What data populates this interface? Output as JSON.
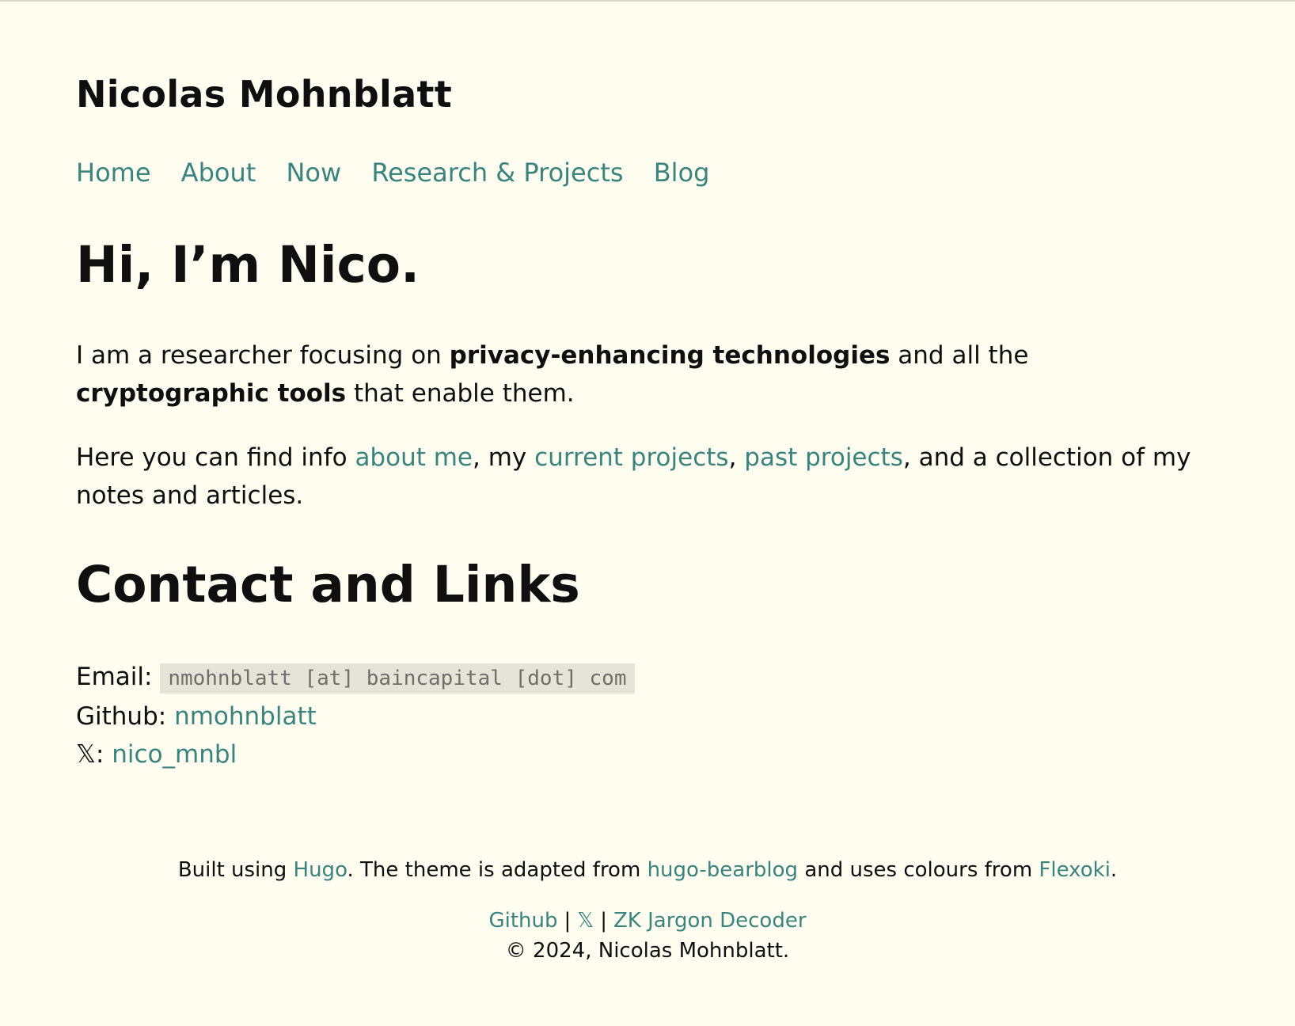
{
  "header": {
    "title": "Nicolas Mohnblatt"
  },
  "nav": {
    "items": [
      "Home",
      "About",
      "Now",
      "Research & Projects",
      "Blog"
    ]
  },
  "main": {
    "heading": "Hi, I’m Nico.",
    "intro": {
      "t1": "I am a researcher focusing on ",
      "b1": "privacy-enhancing technologies",
      "t2": " and all the ",
      "b2": "cryptographic tools",
      "t3": " that enable them."
    },
    "info": {
      "t1": "Here you can find info ",
      "link1": "about me",
      "t2": ", my ",
      "link2": "current projects",
      "t3": ", ",
      "link3": "past projects",
      "t4": ", and a collection of my notes and articles."
    },
    "contact_heading": "Contact and Links",
    "contact": {
      "email_label": "Email: ",
      "email_value": "nmohnblatt [at] baincapital [dot] com",
      "github_label": "Github: ",
      "github_value": "nmohnblatt",
      "x_label": "𝕏: ",
      "x_value": "nico_mnbl"
    }
  },
  "footer": {
    "line1": {
      "t1": "Built using ",
      "link1": "Hugo",
      "t2": ". The theme is adapted from ",
      "link2": "hugo-bearblog",
      "t3": " and uses colours from ",
      "link3": "Flexoki",
      "t4": "."
    },
    "links": {
      "github": "Github",
      "sep": "|",
      "x": "𝕏",
      "zk": "ZK Jargon Decoder"
    },
    "copyright": "© 2024, Nicolas Mohnblatt."
  },
  "colors": {
    "background": "#FFFCF0",
    "text": "#100F0F",
    "link": "#3A837E",
    "code_bg": "#E6E4D9"
  }
}
